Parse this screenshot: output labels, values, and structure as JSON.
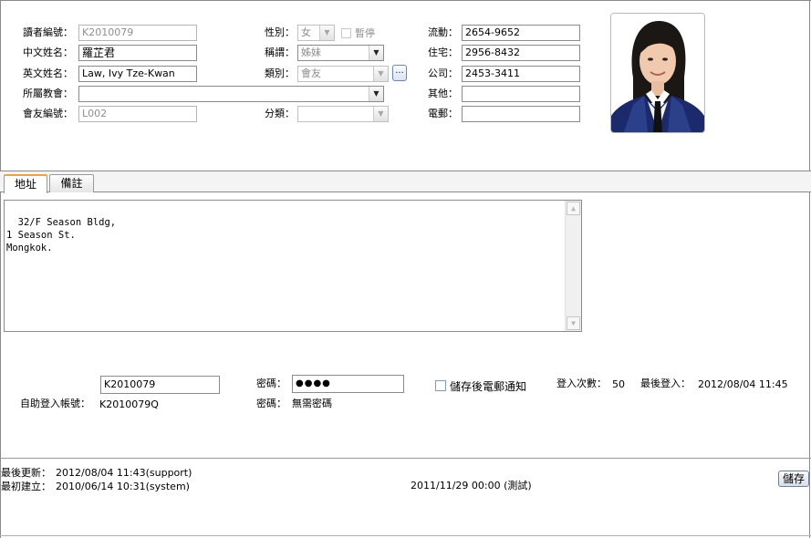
{
  "form": {
    "reader_id": {
      "label": "讀者編號：",
      "value": "K2010079"
    },
    "chinese_name": {
      "label": "中文姓名：",
      "value": "羅芷君"
    },
    "english_name": {
      "label": "英文姓名：",
      "value": "Law, Ivy Tze-Kwan"
    },
    "church": {
      "label": "所屬教會：",
      "value": ""
    },
    "member_id": {
      "label": "會友編號：",
      "value": "L002"
    },
    "gender": {
      "label": "性別：",
      "value": "女"
    },
    "suspend": {
      "label": "暫停",
      "checked": false
    },
    "title": {
      "label": "稱謂：",
      "value": "姊妹"
    },
    "type": {
      "label": "類別：",
      "value": "會友"
    },
    "ellipsis_button": "...",
    "category": {
      "label": "分類：",
      "value": ""
    },
    "mobile": {
      "label": "流動：",
      "value": "2654-9652"
    },
    "home": {
      "label": "住宅：",
      "value": "2956-8432"
    },
    "office": {
      "label": "公司：",
      "value": "2453-3411"
    },
    "other": {
      "label": "其他：",
      "value": ""
    },
    "email": {
      "label": "電郵：",
      "value": ""
    }
  },
  "tabs": [
    {
      "label": "地址",
      "active": true
    },
    {
      "label": "備註",
      "active": false
    }
  ],
  "address_text": "32/F Season Bldg,\n1 Season St.\nMongkok.",
  "login": {
    "username_value": "K2010079",
    "password_label": "密碼：",
    "password_value": "●●●●",
    "email_notify_label": "儲存後電郵通知",
    "login_count_label": "登入次數：",
    "login_count_value": "50",
    "last_login_label": "最後登入：",
    "last_login_value": "2012/08/04 11:45",
    "self_login_account_label": "自助登入帳號：",
    "self_login_account_value": "K2010079Q",
    "password_label_2": "密碼：",
    "password_status": "無需密碼"
  },
  "footer": {
    "last_updated_label": "最後更新：",
    "last_updated_value": "2012/08/04 11:43(support)",
    "created_label": "最初建立：",
    "created_value": "2010/06/14 10:31(system)",
    "center_text": "2011/11/29 00:00 (測試)",
    "save_button": "儲存"
  },
  "colors": {
    "tab_accent": "#e8a34a",
    "border": "#8a8a8a",
    "button_border": "#6f7f95"
  }
}
